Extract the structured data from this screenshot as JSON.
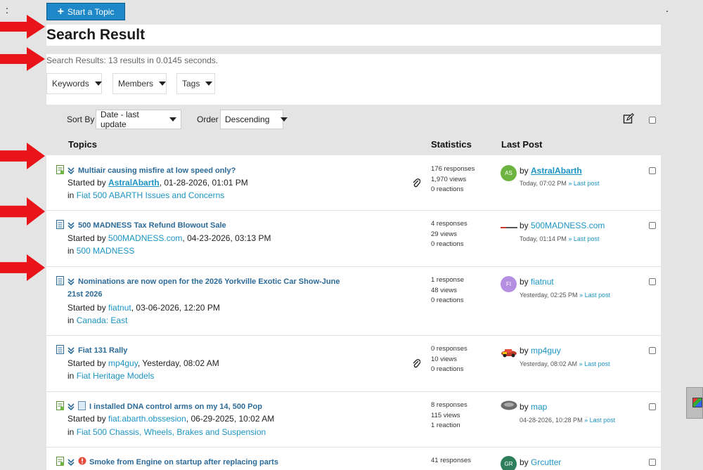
{
  "header": {
    "start_topic_label": "Start a Topic",
    "page_title": "Search Result"
  },
  "search": {
    "result_text": "Search Results: 13 results in 0.0145 seconds.",
    "filters": [
      "Keywords",
      "Members",
      "Tags"
    ]
  },
  "sort": {
    "sort_by_label": "Sort By",
    "sort_by_value": "Date - last update",
    "order_label": "Order",
    "order_value": "Descending"
  },
  "columns": {
    "topics": "Topics",
    "statistics": "Statistics",
    "last_post": "Last Post"
  },
  "topics": [
    {
      "title_line1": "Multiair causing misfire at low speed only?",
      "title_line2": "",
      "started_prefix": "Started by ",
      "author": "AstralAbarth",
      "started_date": ", 01-28-2026, 01:01 PM",
      "in_prefix": "in ",
      "forum": "Fiat 500 ABARTH Issues and Concerns",
      "responses": "176 responses",
      "views": "1,970 views",
      "reactions": "0 reactions",
      "lp_by": "by ",
      "lp_user": "AstralAbarth",
      "lp_time": "Today, 07:02 PM",
      "lp_link": "Last post",
      "avatar_text": "AS",
      "avatar_color": "#6cb33f"
    },
    {
      "title_line1": "500 MADNESS Tax Refund Blowout Sale",
      "title_line2": "",
      "started_prefix": "Started by ",
      "author": "500MADNESS.com",
      "started_date": ", 04-23-2026, 03:13 PM",
      "in_prefix": "in ",
      "forum": "500 MADNESS",
      "responses": "4 responses",
      "views": "29 views",
      "reactions": "0 reactions",
      "lp_by": "by ",
      "lp_user": "500MADNESS.com",
      "lp_time": "Today, 01:14 PM",
      "lp_link": "Last post",
      "avatar_text": "",
      "avatar_color": "#ffffff"
    },
    {
      "title_line1": "Nominations are now open for the 2026 Yorkville Exotic Car Show-June",
      "title_line2": "21st 2026",
      "started_prefix": "Started by ",
      "author": "fiatnut",
      "started_date": ", 03-06-2026, 12:20 PM",
      "in_prefix": "in ",
      "forum": "Canada: East",
      "responses": "1 response",
      "views": "48 views",
      "reactions": "0 reactions",
      "lp_by": "by ",
      "lp_user": "fiatnut",
      "lp_time": "Yesterday, 02:25 PM",
      "lp_link": "Last post",
      "avatar_text": "FI",
      "avatar_color": "#b48ee0"
    },
    {
      "title_line1": "Fiat 131 Rally",
      "title_line2": "",
      "started_prefix": "Started by ",
      "author": "mp4guy",
      "started_date": ", Yesterday, 08:02 AM",
      "in_prefix": "in ",
      "forum": "Fiat Heritage Models",
      "responses": "0 responses",
      "views": "10 views",
      "reactions": "0 reactions",
      "lp_by": "by ",
      "lp_user": "mp4guy",
      "lp_time": "Yesterday, 08:02 AM",
      "lp_link": "Last post",
      "avatar_text": "",
      "avatar_color": "#ffffff"
    },
    {
      "title_line1": "I installed DNA control arms on my 14, 500 Pop",
      "title_line2": "",
      "started_prefix": "Started by ",
      "author": "fiat.abarth.obssesion",
      "started_date": ", 06-29-2025, 10:02 AM",
      "in_prefix": "in ",
      "forum": "Fiat 500 Chassis, Wheels, Brakes and Suspension",
      "responses": "8 responses",
      "views": "115 views",
      "reactions": "1 reaction",
      "lp_by": "by ",
      "lp_user": "map",
      "lp_time": "04-28-2026, 10:28 PM",
      "lp_link": "Last post",
      "avatar_text": "",
      "avatar_color": "#777777"
    },
    {
      "title_line1": "Smoke from Engine on startup after replacing parts",
      "title_line2": "",
      "responses": "41 responses",
      "lp_by": "by ",
      "lp_user": "Grcutter",
      "avatar_text": "GR",
      "avatar_color": "#2e7d5b"
    }
  ],
  "colors": {
    "primary": "#1e88c8",
    "link": "#1c94c4",
    "title": "#2c6a98",
    "arrow": "#e8141a"
  }
}
